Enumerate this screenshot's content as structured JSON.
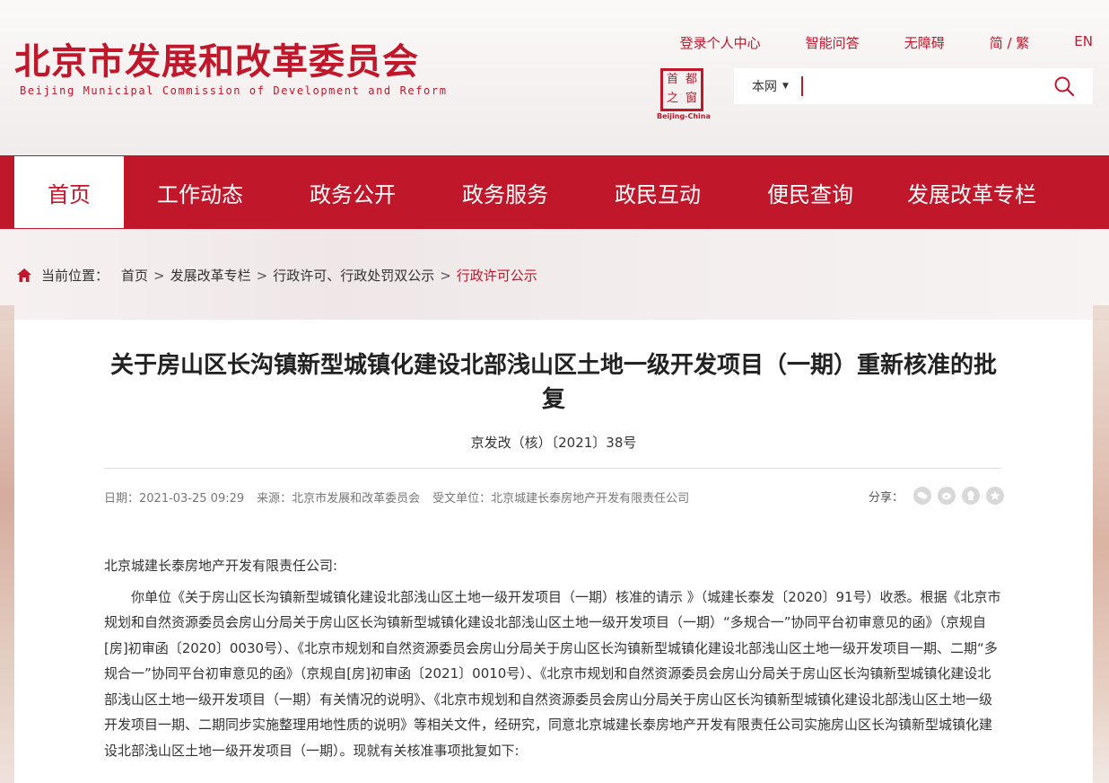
{
  "header": {
    "logo_cn": "北京市发展和改革委员会",
    "logo_en": "Beijing Municipal Commission of Development and Reform",
    "top_links": [
      "登录个人中心",
      "智能问答",
      "无障碍",
      "简 / 繁",
      "EN"
    ],
    "seal_chars": [
      "首",
      "都",
      "之",
      "窗"
    ],
    "seal_en": "Beijing-China",
    "search": {
      "scope": "本网",
      "placeholder": ""
    }
  },
  "nav": {
    "items": [
      "首页",
      "工作动态",
      "政务公开",
      "政务服务",
      "政民互动",
      "便民查询",
      "发展改革专栏"
    ],
    "active_index": 0
  },
  "breadcrumb": {
    "label": "当前位置：",
    "items": [
      "首页",
      "发展改革专栏",
      "行政许可、行政处罚双公示",
      "行政许可公示"
    ]
  },
  "article": {
    "title": "关于房山区长沟镇新型城镇化建设北部浅山区土地一级开发项目（一期）重新核准的批复",
    "doc_number": "京发改（核）〔2021〕38号",
    "date": "日期：2021-03-25 09:29",
    "source": "来源：北京市发展和改革委员会",
    "recipient": "受文单位：北京城建长泰房地产开发有限责任公司",
    "share_label": "分享：",
    "salutation": "北京城建长泰房地产开发有限责任公司:",
    "paragraph": "你单位《关于房山区长沟镇新型城镇化建设北部浅山区土地一级开发项目（一期）核准的请示 》（城建长泰发〔2020〕91号）收悉。根据《北京市规划和自然资源委员会房山分局关于房山区长沟镇新型城镇化建设北部浅山区土地一级开发项目（一期）“多规合一”协同平台初审意见的函》（京规自[房]初审函〔2020〕0030号）、《北京市规划和自然资源委员会房山分局关于房山区长沟镇新型城镇化建设北部浅山区土地一级开发项目一期、二期“多规合一”协同平台初审意见的函》（京规自[房]初审函〔2021〕0010号）、《北京市规划和自然资源委员会房山分局关于房山区长沟镇新型城镇化建设北部浅山区土地一级开发项目（一期）有关情况的说明》、《北京市规划和自然资源委员会房山分局关于房山区长沟镇新型城镇化建设北部浅山区土地一级开发项目一期、二期同步实施整理用地性质的说明》等相关文件，经研究，同意北京城建长泰房地产开发有限责任公司实施房山区长沟镇新型城镇化建设北部浅山区土地一级开发项目（一期）。现就有关核准事项批复如下:"
  },
  "colors": {
    "brand_red": "#c0172b"
  }
}
